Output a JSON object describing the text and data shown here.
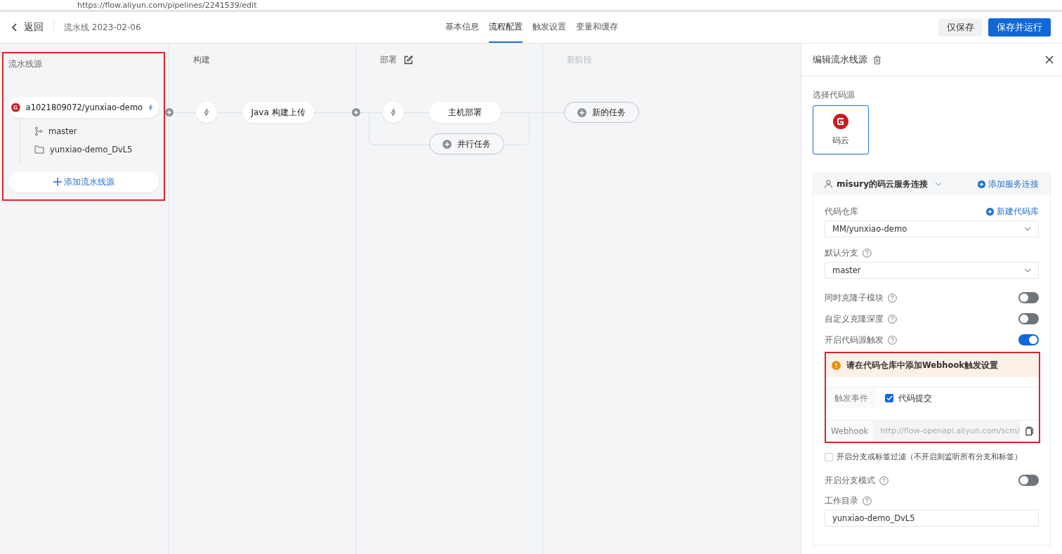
{
  "browser": {
    "url": "https://flow.aliyun.com/pipelines/2241539/edit"
  },
  "header": {
    "back": "返回",
    "title": "流水线 2023-02-06",
    "tabs": [
      {
        "label": "基本信息",
        "selected": false
      },
      {
        "label": "流程配置",
        "selected": true
      },
      {
        "label": "触发设置",
        "selected": false
      },
      {
        "label": "变量和缓存",
        "selected": false
      }
    ],
    "buttons": [
      {
        "label": "仅保存",
        "kind": "secondary"
      },
      {
        "label": "保存并运行",
        "kind": "primary"
      }
    ]
  },
  "source_stage": {
    "title": "流水线源",
    "highlighted": true,
    "repo": "a1021809072/yunxiao-demo",
    "branch": "master",
    "directory": "yunxiao-demo_DvL5",
    "add_button": "添加流水线源"
  },
  "stages": [
    {
      "title": "构建",
      "kind": "stage",
      "editable": false,
      "jobs": [
        "Java 构建上传"
      ]
    },
    {
      "title": "部署",
      "kind": "stage",
      "editable": true,
      "jobs": [
        "主机部署"
      ],
      "parallel_button": "并行任务"
    },
    {
      "title": "新阶段",
      "kind": "new",
      "new_task": "新的任务"
    }
  ],
  "panel": {
    "title": "编辑流水线源",
    "source_label": "选择代码源",
    "source_card": {
      "label": "码云",
      "selected": true
    },
    "connection": "misury的码云服务连接",
    "add_connection": "添加服务连接",
    "repo": {
      "label": "代码仓库",
      "action": "新建代码库",
      "value": "MM/yunxiao-demo"
    },
    "branch": {
      "label": "默认分支",
      "value": "master"
    },
    "toggles": [
      {
        "label": "同时克隆子模块",
        "on": false
      },
      {
        "label": "自定义克隆深度",
        "on": false
      },
      {
        "label": "开启代码源触发",
        "on": true
      }
    ],
    "webhook": {
      "highlighted": true,
      "warning": "请在代码仓库中添加Webhook触发设置",
      "event_label": "触发事件",
      "event": {
        "label": "代码提交",
        "checked": true
      },
      "url_label": "Webhook",
      "url": "http://flow-openapi.aliyun.com/scm/"
    },
    "filter": {
      "label": "开启分支或标签过滤（不开启则监听所有分支和标签）",
      "checked": false
    },
    "branch_mode": {
      "label": "开启分支模式",
      "on": false
    },
    "workdir": {
      "label": "工作目录",
      "value": "yunxiao-demo_DvL5"
    }
  }
}
